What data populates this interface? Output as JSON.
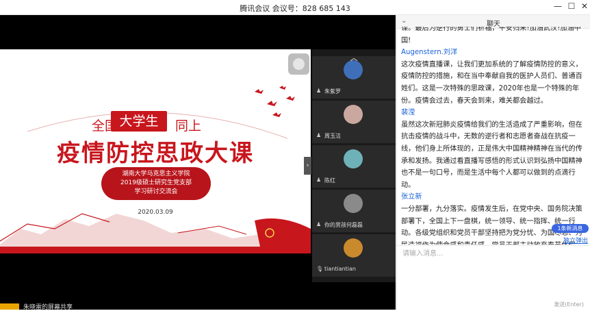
{
  "window": {
    "title": "腾讯会议 会议号：828 685 143",
    "controls": {
      "minimize": "—",
      "maximize": "☐",
      "close": "✕"
    }
  },
  "slide": {
    "subtitle_left": "全国",
    "subtitle_highlight": "大学生",
    "subtitle_right": "同上",
    "main_title": "疫情防控思政大课",
    "org_line1": "湖南大学马克思主义学院",
    "org_line2": "2019级硕士研究生党支部",
    "org_line3": "学习研讨交流会",
    "date": "2020.03.09"
  },
  "participants": [
    {
      "name": "朱紫罗",
      "color": "#3f6fb8"
    },
    {
      "name": "周玉洁",
      "color": "#caa8a0"
    },
    {
      "name": "陈红",
      "color": "#6fb1b8"
    },
    {
      "name": "你的男孩何磊磊",
      "color": "#8a8a8a"
    },
    {
      "name": "tiantiantian",
      "color": "#c98a2e"
    }
  ],
  "bottom": {
    "text": "朱晓雷的屏幕共享"
  },
  "chat": {
    "header": "聊天",
    "messages": [
      {
        "sender": "",
        "text": "谍。最后为逆行的勇士们祈福，平安归来!加油武汉!加油中国!"
      },
      {
        "sender": "Augenstern.刘洋",
        "text": "这次疫情直播课，让我们更加系统的了解疫情防控的意义，疫情防控的措施，和在当中奉献自我的医护人员们、普通百姓们。这是一次特殊的思政课，2020年也是一个特殊的年份。疫情会过去，春天会到来，难关都会越过。"
      },
      {
        "sender": "裴滢",
        "text": "虽然这次新冠肺炎疫情给我们的生活造成了严重影响，但在抗击疫情的战斗中，无数的逆行者和志愿者奋战在抗疫一线，他们身上所体现的，正是伟大中国精神精神在当代的传承和发扬。我通过看直播写感悟的形式认识到弘扬中国精神也不是一句口号，而是生活中每个人都可以做到的点滴行动。"
      },
      {
        "sender": "张立新",
        "text": "一分部署，九分落实。疫情发生后，在党中央、国务院决策部署下，全国上下一盘棋，统一领导、统一指挥、统一行动。各级党组织和党员干部坚持把为党分忧、为国尽忠、为民造福作为使命感和责任感。党员干部主动放弃春节休假，积极投身疫情防控工作，发挥战斗堡垒作用和先锋模范作用。"
      }
    ],
    "new_messages": "1条新消息",
    "pop_out": "独立弹出",
    "input_placeholder": "请输入消息...",
    "send_hint": "发送(Enter)"
  }
}
